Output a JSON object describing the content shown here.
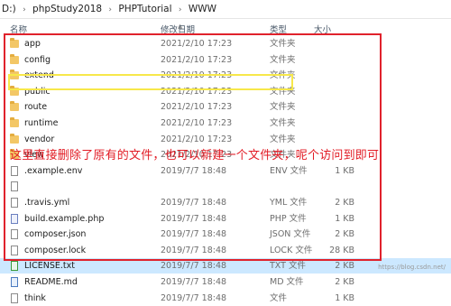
{
  "breadcrumb": [
    "D:)",
    "phpStudy2018",
    "PHPTutorial",
    "WWW"
  ],
  "columns": {
    "name": "名称",
    "date": "修改日期",
    "type": "类型",
    "size": "大小"
  },
  "files": [
    {
      "name": "app",
      "date": "2021/2/10 17:23",
      "type": "文件夹",
      "size": "",
      "icon": "folder-icon",
      "kind": "folder"
    },
    {
      "name": "config",
      "date": "2021/2/10 17:23",
      "type": "文件夹",
      "size": "",
      "icon": "folder-icon",
      "kind": "folder"
    },
    {
      "name": "extend",
      "date": "2021/2/10 17:23",
      "type": "文件夹",
      "size": "",
      "icon": "folder-icon",
      "kind": "folder"
    },
    {
      "name": "public",
      "date": "2021/2/10 17:23",
      "type": "文件夹",
      "size": "",
      "icon": "folder-icon",
      "kind": "folder"
    },
    {
      "name": "route",
      "date": "2021/2/10 17:23",
      "type": "文件夹",
      "size": "",
      "icon": "folder-icon",
      "kind": "folder"
    },
    {
      "name": "runtime",
      "date": "2021/2/10 17:23",
      "type": "文件夹",
      "size": "",
      "icon": "folder-icon",
      "kind": "folder"
    },
    {
      "name": "vendor",
      "date": "2021/2/10 17:23",
      "type": "文件夹",
      "size": "",
      "icon": "folder-icon",
      "kind": "folder"
    },
    {
      "name": "view",
      "date": "2021/2/10 17:23",
      "type": "文件夹",
      "size": "",
      "icon": "folder-icon",
      "kind": "folder"
    },
    {
      "name": ".example.env",
      "date": "2019/7/7 18:48",
      "type": "ENV 文件",
      "size": "1 KB",
      "icon": "file-icon",
      "kind": "file"
    },
    {
      "name": "",
      "date": "",
      "type": "",
      "size": "",
      "icon": "file-icon",
      "kind": "file"
    },
    {
      "name": ".travis.yml",
      "date": "2019/7/7 18:48",
      "type": "YML 文件",
      "size": "2 KB",
      "icon": "file-icon",
      "kind": "file"
    },
    {
      "name": "build.example.php",
      "date": "2019/7/7 18:48",
      "type": "PHP 文件",
      "size": "1 KB",
      "icon": "php-file-icon",
      "kind": "php"
    },
    {
      "name": "composer.json",
      "date": "2019/7/7 18:48",
      "type": "JSON 文件",
      "size": "2 KB",
      "icon": "file-icon",
      "kind": "file"
    },
    {
      "name": "composer.lock",
      "date": "2019/7/7 18:48",
      "type": "LOCK 文件",
      "size": "28 KB",
      "icon": "file-icon",
      "kind": "file"
    },
    {
      "name": "LICENSE.txt",
      "date": "2019/7/7 18:48",
      "type": "TXT 文件",
      "size": "2 KB",
      "icon": "txt-file-icon",
      "kind": "txt"
    },
    {
      "name": "README.md",
      "date": "2019/7/7 18:48",
      "type": "MD 文件",
      "size": "2 KB",
      "icon": "md-file-icon",
      "kind": "md"
    },
    {
      "name": "think",
      "date": "2019/7/7 18:48",
      "type": "文件",
      "size": "1 KB",
      "icon": "file-icon",
      "kind": "file"
    }
  ],
  "selected_index": 14,
  "annotation": "这里直接删除了原有的文件，也可以新建一个文件夹，呢个访问到即可",
  "watermark": "https://blog.csdn.net/",
  "colors": {
    "highlight_box": "#e0222c",
    "selection_box": "#f7e84a",
    "annotation_text": "#e21b24",
    "selected_row": "#cce8ff"
  }
}
